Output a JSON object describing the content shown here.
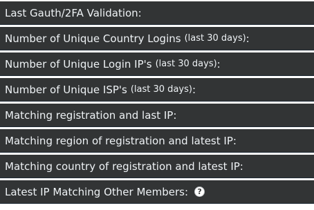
{
  "rows": [
    {
      "label": "Last Gauth/2FA Validation:",
      "sub": "",
      "colon": ""
    },
    {
      "label": "Number of Unique Country Logins",
      "sub": "(last 30 days)",
      "colon": ":"
    },
    {
      "label": "Number of Unique Login IP's",
      "sub": "(last 30 days)",
      "colon": ":"
    },
    {
      "label": "Number of Unique ISP's",
      "sub": "(last 30 days)",
      "colon": ":"
    },
    {
      "label": "Matching registration and last IP:",
      "sub": "",
      "colon": ""
    },
    {
      "label": "Matching region of registration and latest IP:",
      "sub": "",
      "colon": ""
    },
    {
      "label": "Matching country of registration and latest IP:",
      "sub": "",
      "colon": ""
    },
    {
      "label": "Latest IP Matching Other Members:",
      "sub": "",
      "colon": ""
    }
  ],
  "help_icon": {
    "glyph": "?",
    "icon": "question-circle-icon"
  },
  "colors": {
    "row_bg": "#323435",
    "text": "#eef2f5",
    "border": "#1f2a35"
  }
}
